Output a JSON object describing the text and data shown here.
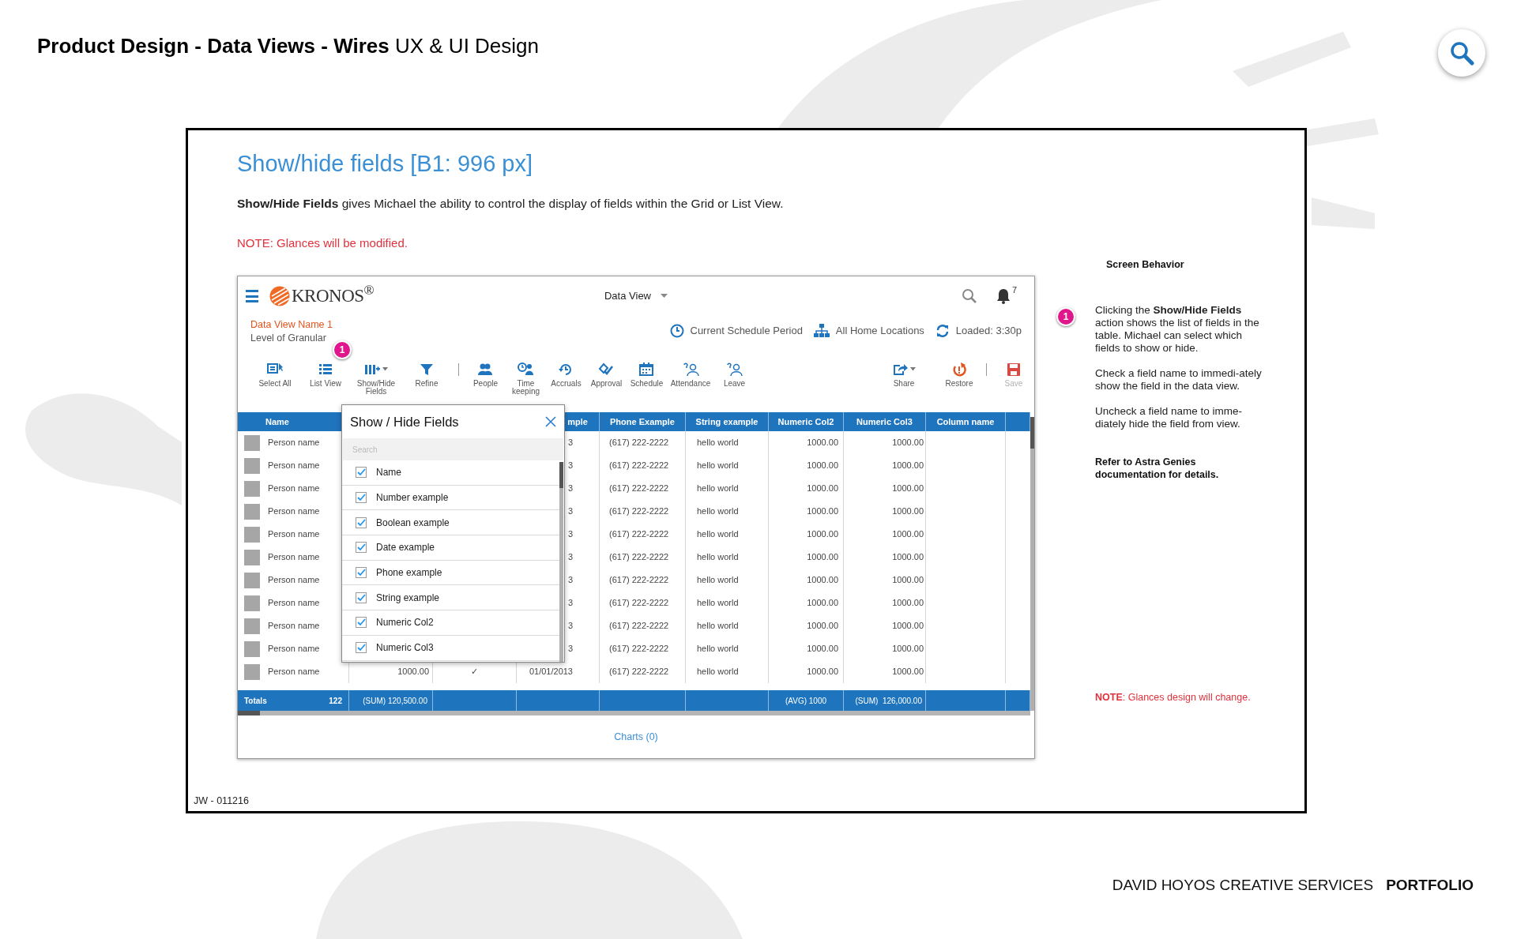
{
  "header": {
    "title": "**Product Design - Data Views - Wires** UX & UI Design"
  },
  "slide": {
    "heading": "Show/hide fields [B1: 996 px]",
    "description": "**Show/Hide Fields** gives Michael the ability to control the display of fields within the Grid or List View.",
    "note": "NOTE: Glances will be modified.",
    "app": {
      "logo": "KRONOS$^{®}$",
      "view_menu": "Data View",
      "notifications": "7",
      "view_name": "Data View Name 1",
      "granularity": "Level of Granular",
      "badge": "1",
      "filters": [
        "Current Schedule Period",
        "All Home Locations",
        "Loaded: 3:30p"
      ],
      "actions": [
        [
          {
            "label": "Select All",
            "menu": false,
            "disabled": false
          },
          {
            "label": "List View",
            "menu": false,
            "disabled": false
          },
          {
            "label": "Show/Hide Fields",
            "menu": true,
            "disabled": false
          },
          {
            "label": "Refine",
            "menu": false,
            "disabled": false
          }
        ],
        [
          {
            "label": "People",
            "menu": false,
            "disabled": false
          },
          {
            "label": "Time keeping",
            "menu": false,
            "disabled": false
          },
          {
            "label": "Accruals",
            "menu": false,
            "disabled": false
          },
          {
            "label": "Approval",
            "menu": false,
            "disabled": false
          },
          {
            "label": "Schedule",
            "menu": false,
            "disabled": false
          },
          {
            "label": "Attendance",
            "menu": false,
            "disabled": false
          },
          {
            "label": "Leave",
            "menu": false,
            "disabled": false
          }
        ]
      ],
      "page_actions": [
        [
          {
            "label": "Share",
            "menu": true,
            "disabled": false
          },
          {
            "label": "Restore",
            "menu": false,
            "disabled": false
          }
        ],
        [
          {
            "label": "Save",
            "menu": false,
            "disabled": true
          }
        ]
      ],
      "table": {
        "columns": [
          "Name",
          null,
          null,
          "mple",
          "Phone Example",
          "String example",
          "Numeric Col2",
          "Numeric Col3",
          "Column name"
        ],
        "rows": [
          [
            "Person name",
            null,
            null,
            "3",
            "(617) 222-2222",
            "hello world",
            "1000.00",
            "1000.00",
            null
          ],
          [
            "Person name",
            null,
            null,
            "3",
            "(617) 222-2222",
            "hello world",
            "1000.00",
            "1000.00",
            null
          ],
          [
            "Person name",
            null,
            null,
            "3",
            "(617) 222-2222",
            "hello world",
            "1000.00",
            "1000.00",
            null
          ],
          [
            "Person name",
            null,
            null,
            "3",
            "(617) 222-2222",
            "hello world",
            "1000.00",
            "1000.00",
            null
          ],
          [
            "Person name",
            null,
            null,
            "3",
            "(617) 222-2222",
            "hello world",
            "1000.00",
            "1000.00",
            null
          ],
          [
            "Person name",
            null,
            null,
            "3",
            "(617) 222-2222",
            "hello world",
            "1000.00",
            "1000.00",
            null
          ],
          [
            "Person name",
            null,
            null,
            "3",
            "(617) 222-2222",
            "hello world",
            "1000.00",
            "1000.00",
            null
          ],
          [
            "Person name",
            null,
            null,
            "3",
            "(617) 222-2222",
            "hello world",
            "1000.00",
            "1000.00",
            null
          ],
          [
            "Person name",
            null,
            null,
            "3",
            "(617) 222-2222",
            "hello world",
            "1000.00",
            "1000.00",
            null
          ],
          [
            "Person name",
            null,
            null,
            "3",
            "(617) 222-2222",
            "hello world",
            "1000.00",
            "1000.00",
            null
          ],
          [
            "Person name",
            "1000.00",
            "✓",
            "01/01/2013",
            "(617) 222-2222",
            "hello world",
            "1000.00",
            "1000.00",
            null
          ]
        ],
        "totals": {
          "label": "Totals",
          "count": "122",
          "cells": [
            "(SUM) 120,500.00",
            null,
            null,
            null,
            null,
            "(AVG) 1000",
            "(SUM)  126,000.00",
            null
          ]
        }
      },
      "popup": {
        "title": "Show / Hide Fields",
        "search": {
          "placeholder": "Search"
        },
        "fields": [
          {
            "label": "Name",
            "checked": true
          },
          {
            "label": "Number example",
            "checked": true
          },
          {
            "label": "Boolean example",
            "checked": true
          },
          {
            "label": "Date example",
            "checked": true
          },
          {
            "label": "Phone example",
            "checked": true
          },
          {
            "label": "String example",
            "checked": true
          },
          {
            "label": "Numeric Col2",
            "checked": true
          },
          {
            "label": "Numeric Col3",
            "checked": true
          }
        ]
      },
      "charts_link": "Charts (0)"
    },
    "screen_behavior": {
      "title": "Screen Behavior",
      "badge": "1",
      "paragraphs": [
        "Clicking the **Show/Hide Fields** action shows the list of fields in the table. Michael can select which fields to show or hide.",
        "Check a field name to immedi-ately show the field in the data view.",
        "Uncheck a field name to imme-diately hide the field from view."
      ],
      "reference": "Refer to Astra Genies documentation for details.",
      "note": "**NOTE**: Glances design will change."
    },
    "code": "JW - 011216"
  },
  "footer": {
    "studio": "DAVID HOYOS CREATIVE SERVICES",
    "section": "PORTFOLIO"
  }
}
